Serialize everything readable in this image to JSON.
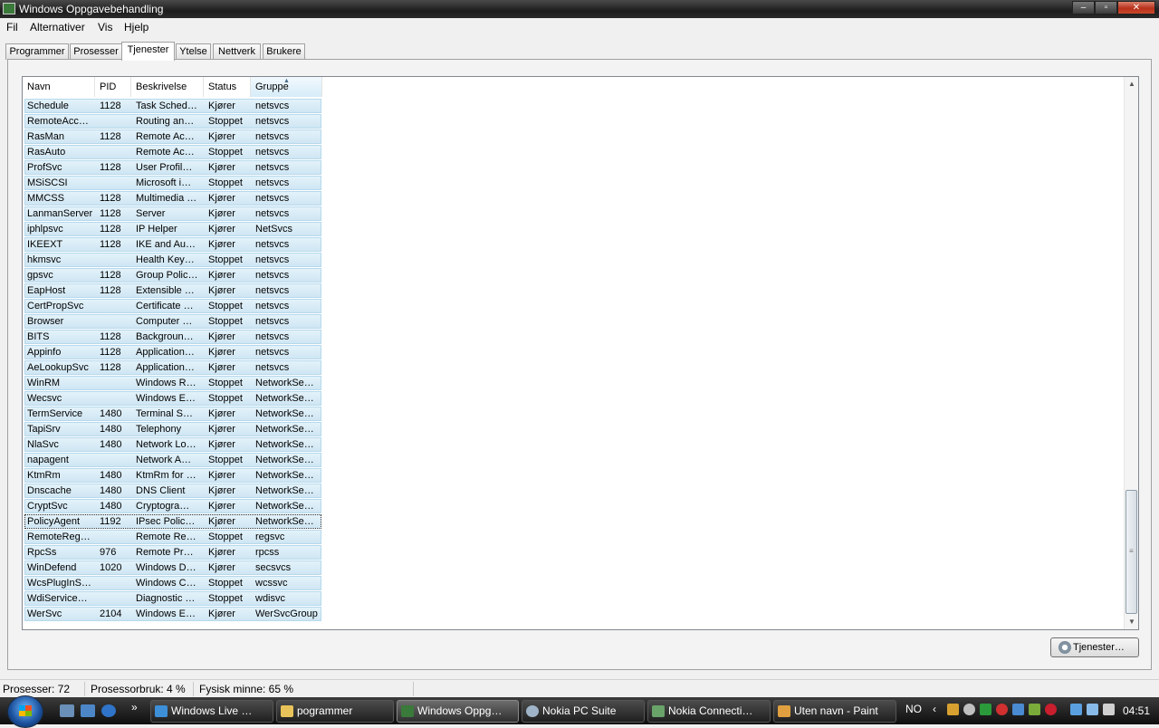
{
  "window": {
    "title": "Windows Oppgavebehandling"
  },
  "menu": [
    "Fil",
    "Alternativer",
    "Vis",
    "Hjelp"
  ],
  "tabs": [
    "Programmer",
    "Prosesser",
    "Tjenester",
    "Ytelse",
    "Nettverk",
    "Brukere"
  ],
  "active_tab": "Tjenester",
  "columns": [
    "Navn",
    "PID",
    "Beskrivelse",
    "Status",
    "Gruppe"
  ],
  "sorted_column": "Gruppe",
  "rows": [
    [
      "Schedule",
      "1128",
      "Task Sched…",
      "Kjører",
      "netsvcs"
    ],
    [
      "RemoteAcc…",
      "",
      "Routing an…",
      "Stoppet",
      "netsvcs"
    ],
    [
      "RasMan",
      "1128",
      "Remote Ac…",
      "Kjører",
      "netsvcs"
    ],
    [
      "RasAuto",
      "",
      "Remote Ac…",
      "Stoppet",
      "netsvcs"
    ],
    [
      "ProfSvc",
      "1128",
      "User Profil…",
      "Kjører",
      "netsvcs"
    ],
    [
      "MSiSCSI",
      "",
      "Microsoft i…",
      "Stoppet",
      "netsvcs"
    ],
    [
      "MMCSS",
      "1128",
      "Multimedia …",
      "Kjører",
      "netsvcs"
    ],
    [
      "LanmanServer",
      "1128",
      "Server",
      "Kjører",
      "netsvcs"
    ],
    [
      "iphlpsvc",
      "1128",
      "IP Helper",
      "Kjører",
      "NetSvcs"
    ],
    [
      "IKEEXT",
      "1128",
      "IKE and Au…",
      "Kjører",
      "netsvcs"
    ],
    [
      "hkmsvc",
      "",
      "Health Key…",
      "Stoppet",
      "netsvcs"
    ],
    [
      "gpsvc",
      "1128",
      "Group Polic…",
      "Kjører",
      "netsvcs"
    ],
    [
      "EapHost",
      "1128",
      "Extensible …",
      "Kjører",
      "netsvcs"
    ],
    [
      "CertPropSvc",
      "",
      "Certificate …",
      "Stoppet",
      "netsvcs"
    ],
    [
      "Browser",
      "",
      "Computer …",
      "Stoppet",
      "netsvcs"
    ],
    [
      "BITS",
      "1128",
      "Backgroun…",
      "Kjører",
      "netsvcs"
    ],
    [
      "Appinfo",
      "1128",
      "Application…",
      "Kjører",
      "netsvcs"
    ],
    [
      "AeLookupSvc",
      "1128",
      "Application…",
      "Kjører",
      "netsvcs"
    ],
    [
      "WinRM",
      "",
      "Windows R…",
      "Stoppet",
      "NetworkSe…"
    ],
    [
      "Wecsvc",
      "",
      "Windows E…",
      "Stoppet",
      "NetworkSe…"
    ],
    [
      "TermService",
      "1480",
      "Terminal S…",
      "Kjører",
      "NetworkSe…"
    ],
    [
      "TapiSrv",
      "1480",
      "Telephony",
      "Kjører",
      "NetworkSe…"
    ],
    [
      "NlaSvc",
      "1480",
      "Network Lo…",
      "Kjører",
      "NetworkSe…"
    ],
    [
      "napagent",
      "",
      "Network A…",
      "Stoppet",
      "NetworkSe…"
    ],
    [
      "KtmRm",
      "1480",
      "KtmRm for …",
      "Kjører",
      "NetworkSe…"
    ],
    [
      "Dnscache",
      "1480",
      "DNS Client",
      "Kjører",
      "NetworkSe…"
    ],
    [
      "CryptSvc",
      "1480",
      "Cryptogra…",
      "Kjører",
      "NetworkSe…"
    ],
    [
      "PolicyAgent",
      "1192",
      "IPsec Polic…",
      "Kjører",
      "NetworkSe…"
    ],
    [
      "RemoteReg…",
      "",
      "Remote Re…",
      "Stoppet",
      "regsvc"
    ],
    [
      "RpcSs",
      "976",
      "Remote Pr…",
      "Kjører",
      "rpcss"
    ],
    [
      "WinDefend",
      "1020",
      "Windows D…",
      "Kjører",
      "secsvcs"
    ],
    [
      "WcsPlugInS…",
      "",
      "Windows C…",
      "Stoppet",
      "wcssvc"
    ],
    [
      "WdiService…",
      "",
      "Diagnostic …",
      "Stoppet",
      "wdisvc"
    ],
    [
      "WerSvc",
      "2104",
      "Windows E…",
      "Kjører",
      "WerSvcGroup"
    ]
  ],
  "focused_row": 27,
  "services_button": "Tjenester…",
  "status": {
    "processes": "Prosesser: 72",
    "cpu": "Prosessorbruk: 4 %",
    "memory": "Fysisk minne: 65 %"
  },
  "taskbar": {
    "buttons": [
      "Windows Live …",
      "pogrammer",
      "Windows Oppg…",
      "Nokia PC Suite",
      "Nokia Connecti…",
      "Uten navn - Paint"
    ],
    "active_button": 2,
    "language": "NO",
    "clock": "04:51"
  },
  "icons": {
    "start": "windows-start-orb",
    "services": "services-gear-icon"
  }
}
